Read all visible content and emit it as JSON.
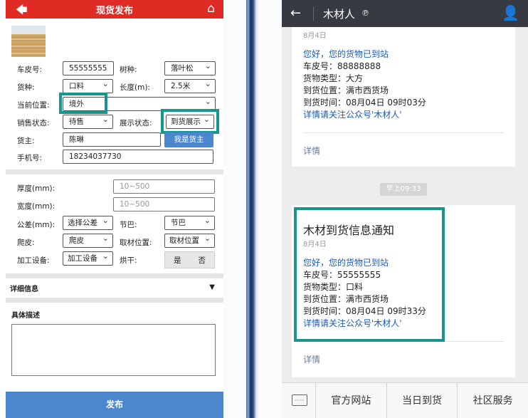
{
  "left": {
    "header": {
      "title": "现货发布",
      "back_icon": "back-arrow-icon",
      "home_icon": "home-icon",
      "color": "#e02b25"
    },
    "form": {
      "plate_label": "车皮号:",
      "plate_value": "55555555",
      "species_label": "树种:",
      "species_value": "落叶松",
      "type_label": "货种:",
      "type_value": "口料",
      "length_label": "长度(m):",
      "length_value": "2.5米",
      "location_label": "当前位置:",
      "location_value": "境外",
      "sale_status_label": "销售状态:",
      "sale_status_value": "待售",
      "display_status_label": "展示状态:",
      "display_status_value": "到货展示",
      "owner_label": "货主:",
      "owner_value": "陈琳",
      "owner_button": "我是货主",
      "phone_label": "手机号:",
      "phone_value": "18234037730"
    },
    "specs": {
      "thickness_label": "厚度(mm):",
      "thickness_placeholder": "10~500",
      "width_label": "宽度(mm):",
      "width_placeholder": "10~500",
      "tolerance_label": "公差(mm):",
      "tolerance_value": "选择公差",
      "knot_label": "节巴:",
      "knot_value": "节巴",
      "peel_label": "爬皮:",
      "peel_value": "爬皮",
      "sample_pos_label": "取材位置:",
      "sample_pos_value": "取材位置",
      "equipment_label": "加工设备:",
      "equipment_value": "加工设备",
      "dry_label": "烘干:",
      "dry_yes": "是",
      "dry_no": "否"
    },
    "details": {
      "label": "详细信息"
    },
    "description": {
      "label": "具体描述"
    },
    "submit_label": "发布"
  },
  "right": {
    "header": {
      "name": "木材人",
      "badge": "℗",
      "back_icon": "back-arrow-icon",
      "user_icon": "user-icon"
    },
    "msg1": {
      "date": "8月4日",
      "greeting": "您好，您的货物已到站",
      "plate": "车皮号：88888888",
      "goods_type": "货物类型：大方",
      "location": "到货位置：满市西货场",
      "time": "到货时间：08月04日 09时03分",
      "follow": "详情请关注公众号'木材人'",
      "more": "详情"
    },
    "timestamp": "早上09:33",
    "msg2": {
      "title": "木材到货信息通知",
      "date": "8月4日",
      "greeting": "您好，您的货物已到站",
      "plate": "车皮号：55555555",
      "goods_type": "货物类型：口料",
      "location": "到货位置：满市西货场",
      "time": "到货时间：08月04日 09时33分",
      "follow": "详情请关注公众号'木材人'",
      "more": "详情"
    },
    "footer": {
      "keyboard_icon": "keyboard-icon",
      "menu1": "官方网站",
      "menu2": "当日到货",
      "menu3": "社区服务"
    }
  },
  "colors": {
    "highlight": "#17958f",
    "button_blue": "#4b87cc",
    "link_blue": "#1a5ab8"
  }
}
